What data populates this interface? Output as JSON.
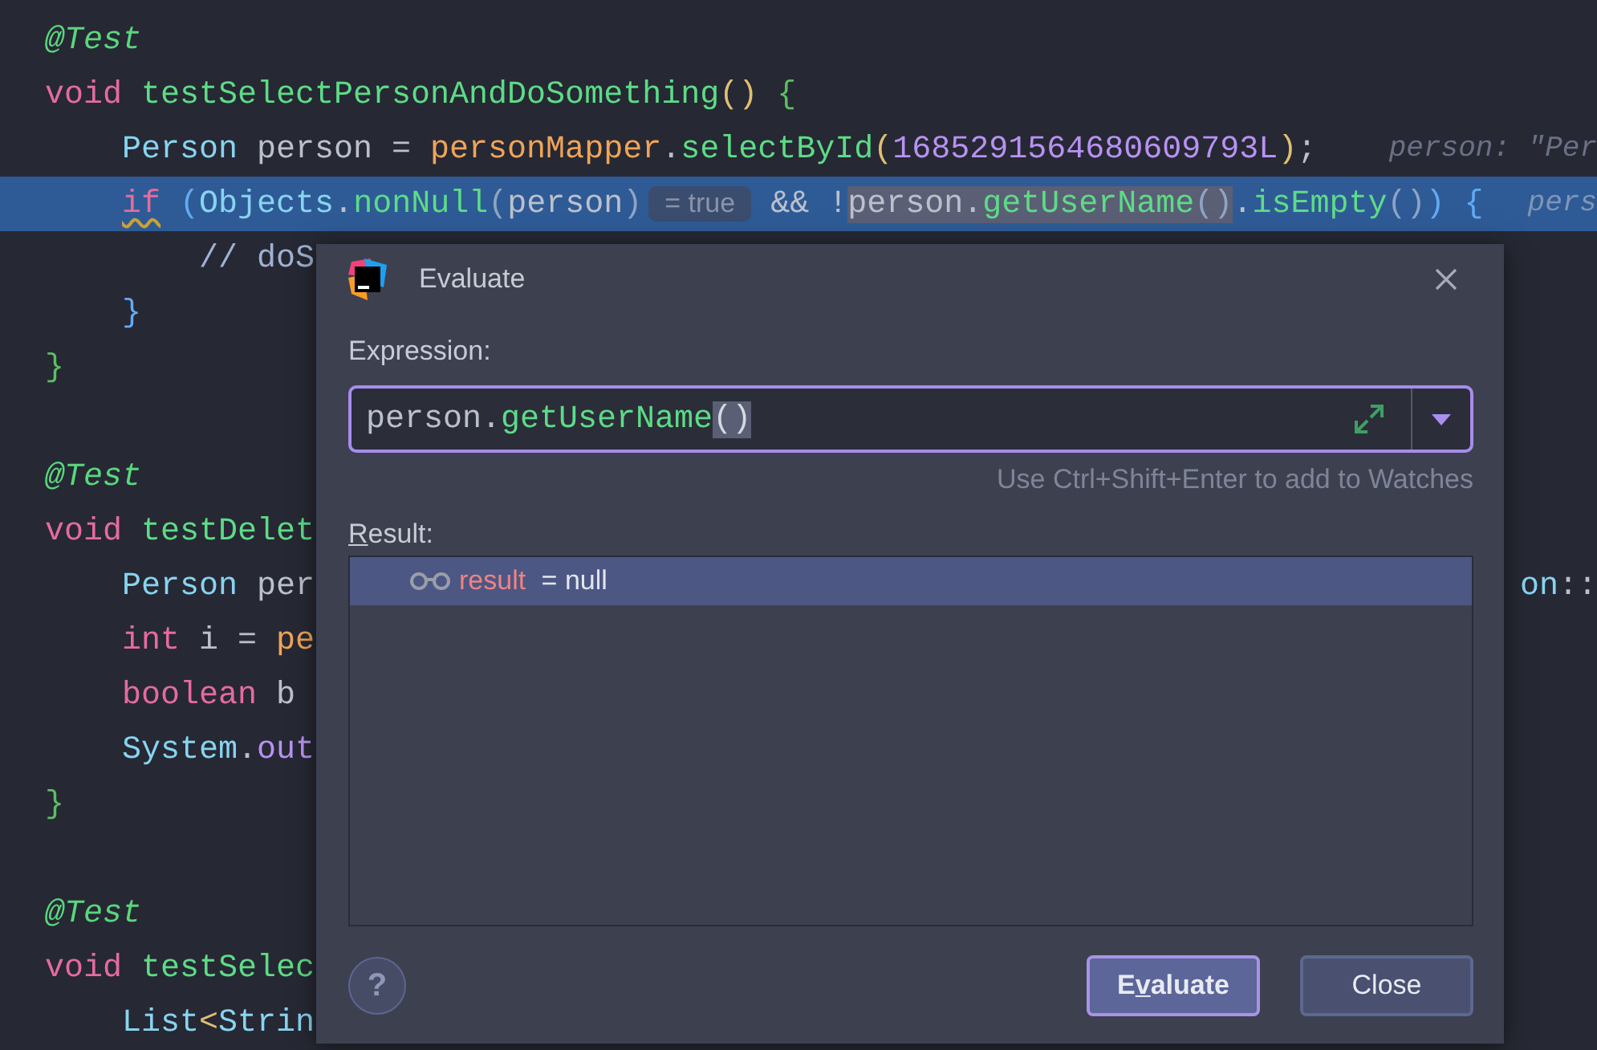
{
  "editor": {
    "lines": [
      {
        "current": false,
        "segments": [
          {
            "kind": "code",
            "tokens": [
              {
                "kind": "ann",
                "text": "@Test"
              }
            ]
          }
        ]
      },
      {
        "current": false,
        "segments": [
          {
            "kind": "code",
            "tokens": [
              {
                "kind": "kw",
                "text": "void"
              },
              {
                "kind": "fn",
                "text": " testSelectPersonAndDoSomething"
              },
              {
                "kind": "paren",
                "text": "()"
              },
              {
                "kind": "brace-green",
                "text": " {"
              }
            ]
          }
        ],
        "children": [
          {
            "current": false,
            "segments": [
              {
                "kind": "code",
                "tokens": [
                  {
                    "kind": "type",
                    "text": "Person"
                  },
                  {
                    "kind": "plain",
                    "text": " person = "
                  },
                  {
                    "kind": "member",
                    "text": "personMapper"
                  },
                  {
                    "kind": "plain",
                    "text": "."
                  },
                  {
                    "kind": "fn",
                    "text": "selectById"
                  },
                  {
                    "kind": "paren",
                    "text": "("
                  },
                  {
                    "kind": "num",
                    "text": "1685291564680609793L"
                  },
                  {
                    "kind": "paren",
                    "text": ")"
                  },
                  {
                    "kind": "plain",
                    "text": ";"
                  }
                ]
              },
              {
                "kind": "hint",
                "text": "person: \"Per"
              }
            ]
          },
          {
            "current": true,
            "segments": [
              {
                "kind": "code",
                "tokens": [
                  {
                    "kind": "kw-warn",
                    "text": "if"
                  },
                  {
                    "kind": "paren-blue",
                    "text": " ("
                  },
                  {
                    "kind": "type",
                    "text": "Objects"
                  },
                  {
                    "kind": "plain",
                    "text": "."
                  },
                  {
                    "kind": "fn",
                    "text": "nonNull"
                  },
                  {
                    "kind": "paren-dim",
                    "text": "("
                  },
                  {
                    "kind": "var",
                    "text": "person"
                  },
                  {
                    "kind": "paren-dim",
                    "text": ")"
                  }
                ]
              },
              {
                "kind": "inlay",
                "text": "= true"
              },
              {
                "kind": "code",
                "tokens": [
                  {
                    "kind": "plain",
                    "text": " && !"
                  },
                  {
                    "kind": "usage",
                    "tokens": [
                      {
                        "kind": "var",
                        "text": "person"
                      },
                      {
                        "kind": "plain",
                        "text": "."
                      },
                      {
                        "kind": "fn",
                        "text": "getUserName"
                      },
                      {
                        "kind": "paren-dim",
                        "text": "()"
                      }
                    ]
                  },
                  {
                    "kind": "plain",
                    "text": "."
                  },
                  {
                    "kind": "fn",
                    "text": "isEmpty"
                  },
                  {
                    "kind": "paren-dim",
                    "text": "()"
                  },
                  {
                    "kind": "paren-blue",
                    "text": ")"
                  },
                  {
                    "kind": "brace-blue",
                    "text": " {"
                  }
                ]
              },
              {
                "kind": "hint",
                "text": "pers"
              }
            ],
            "children": [
              {
                "current": false,
                "segments": [
                  {
                    "kind": "code",
                    "tokens": [
                      {
                        "kind": "comment",
                        "text": "// doS"
                      }
                    ]
                  }
                ]
              }
            ]
          },
          {
            "current": false,
            "segments": [
              {
                "kind": "code",
                "tokens": [
                  {
                    "kind": "brace-blue",
                    "text": "}"
                  }
                ]
              }
            ]
          }
        ]
      },
      {
        "current": false,
        "segments": [
          {
            "kind": "code",
            "tokens": [
              {
                "kind": "brace-green",
                "text": "}"
              }
            ]
          }
        ]
      },
      {
        "current": false
      },
      {
        "current": false,
        "segments": [
          {
            "kind": "code",
            "tokens": [
              {
                "kind": "ann",
                "text": "@Test"
              }
            ]
          }
        ]
      },
      {
        "current": false,
        "segments": [
          {
            "kind": "code",
            "tokens": [
              {
                "kind": "kw",
                "text": "void"
              },
              {
                "kind": "fn",
                "text": " testDelet"
              }
            ]
          }
        ],
        "children": [
          {
            "current": false,
            "segments": [
              {
                "kind": "code",
                "tokens": [
                  {
                    "kind": "type",
                    "text": "Person"
                  },
                  {
                    "kind": "plain",
                    "text": " per"
                  }
                ]
              },
              {
                "kind": "tail",
                "tokens": [
                  {
                    "kind": "type",
                    "text": "on"
                  },
                  {
                    "kind": "plain",
                    "text": "::"
                  }
                ]
              }
            ]
          },
          {
            "current": false,
            "segments": [
              {
                "kind": "code",
                "tokens": [
                  {
                    "kind": "kw",
                    "text": "int"
                  },
                  {
                    "kind": "plain",
                    "text": " i = "
                  },
                  {
                    "kind": "member",
                    "text": "pe"
                  }
                ]
              }
            ]
          },
          {
            "current": false,
            "segments": [
              {
                "kind": "code",
                "tokens": [
                  {
                    "kind": "kw",
                    "text": "boolean"
                  },
                  {
                    "kind": "plain",
                    "text": " b"
                  }
                ]
              }
            ]
          },
          {
            "current": false,
            "segments": [
              {
                "kind": "code",
                "tokens": [
                  {
                    "kind": "type",
                    "text": "System"
                  },
                  {
                    "kind": "plain",
                    "text": "."
                  },
                  {
                    "kind": "field",
                    "text": "out"
                  }
                ]
              }
            ]
          }
        ]
      },
      {
        "current": false,
        "segments": [
          {
            "kind": "code",
            "tokens": [
              {
                "kind": "brace-green",
                "text": "}"
              }
            ]
          }
        ]
      },
      {
        "current": false
      },
      {
        "current": false,
        "segments": [
          {
            "kind": "code",
            "tokens": [
              {
                "kind": "ann",
                "text": "@Test"
              }
            ]
          }
        ]
      },
      {
        "current": false,
        "segments": [
          {
            "kind": "code",
            "tokens": [
              {
                "kind": "kw",
                "text": "void"
              },
              {
                "kind": "fn",
                "text": " testSelec"
              }
            ]
          }
        ],
        "children": [
          {
            "current": false,
            "segments": [
              {
                "kind": "code",
                "tokens": [
                  {
                    "kind": "type",
                    "text": "List"
                  },
                  {
                    "kind": "paren",
                    "text": "<"
                  },
                  {
                    "kind": "type",
                    "text": "Strin"
                  }
                ]
              }
            ]
          }
        ]
      }
    ]
  },
  "dialog": {
    "title": "Evaluate",
    "expression_label": "Expression:",
    "expression": {
      "tokens": [
        {
          "kind": "var",
          "text": "person"
        },
        {
          "kind": "plain",
          "text": "."
        },
        {
          "kind": "fn",
          "text": "getUserName"
        },
        {
          "kind": "selection",
          "text": "()"
        }
      ]
    },
    "shortcut_hint": "Use Ctrl+Shift+Enter to add to Watches",
    "result_label": {
      "mnemonic": "R",
      "after": "esult:"
    },
    "results": [
      {
        "name": "result",
        "value": " = null",
        "selected": true
      }
    ],
    "help_label": "?",
    "buttons": [
      {
        "before": "E",
        "mnemonic": "v",
        "after": "aluate",
        "default": true
      },
      {
        "before": "Close",
        "default": false
      }
    ]
  }
}
